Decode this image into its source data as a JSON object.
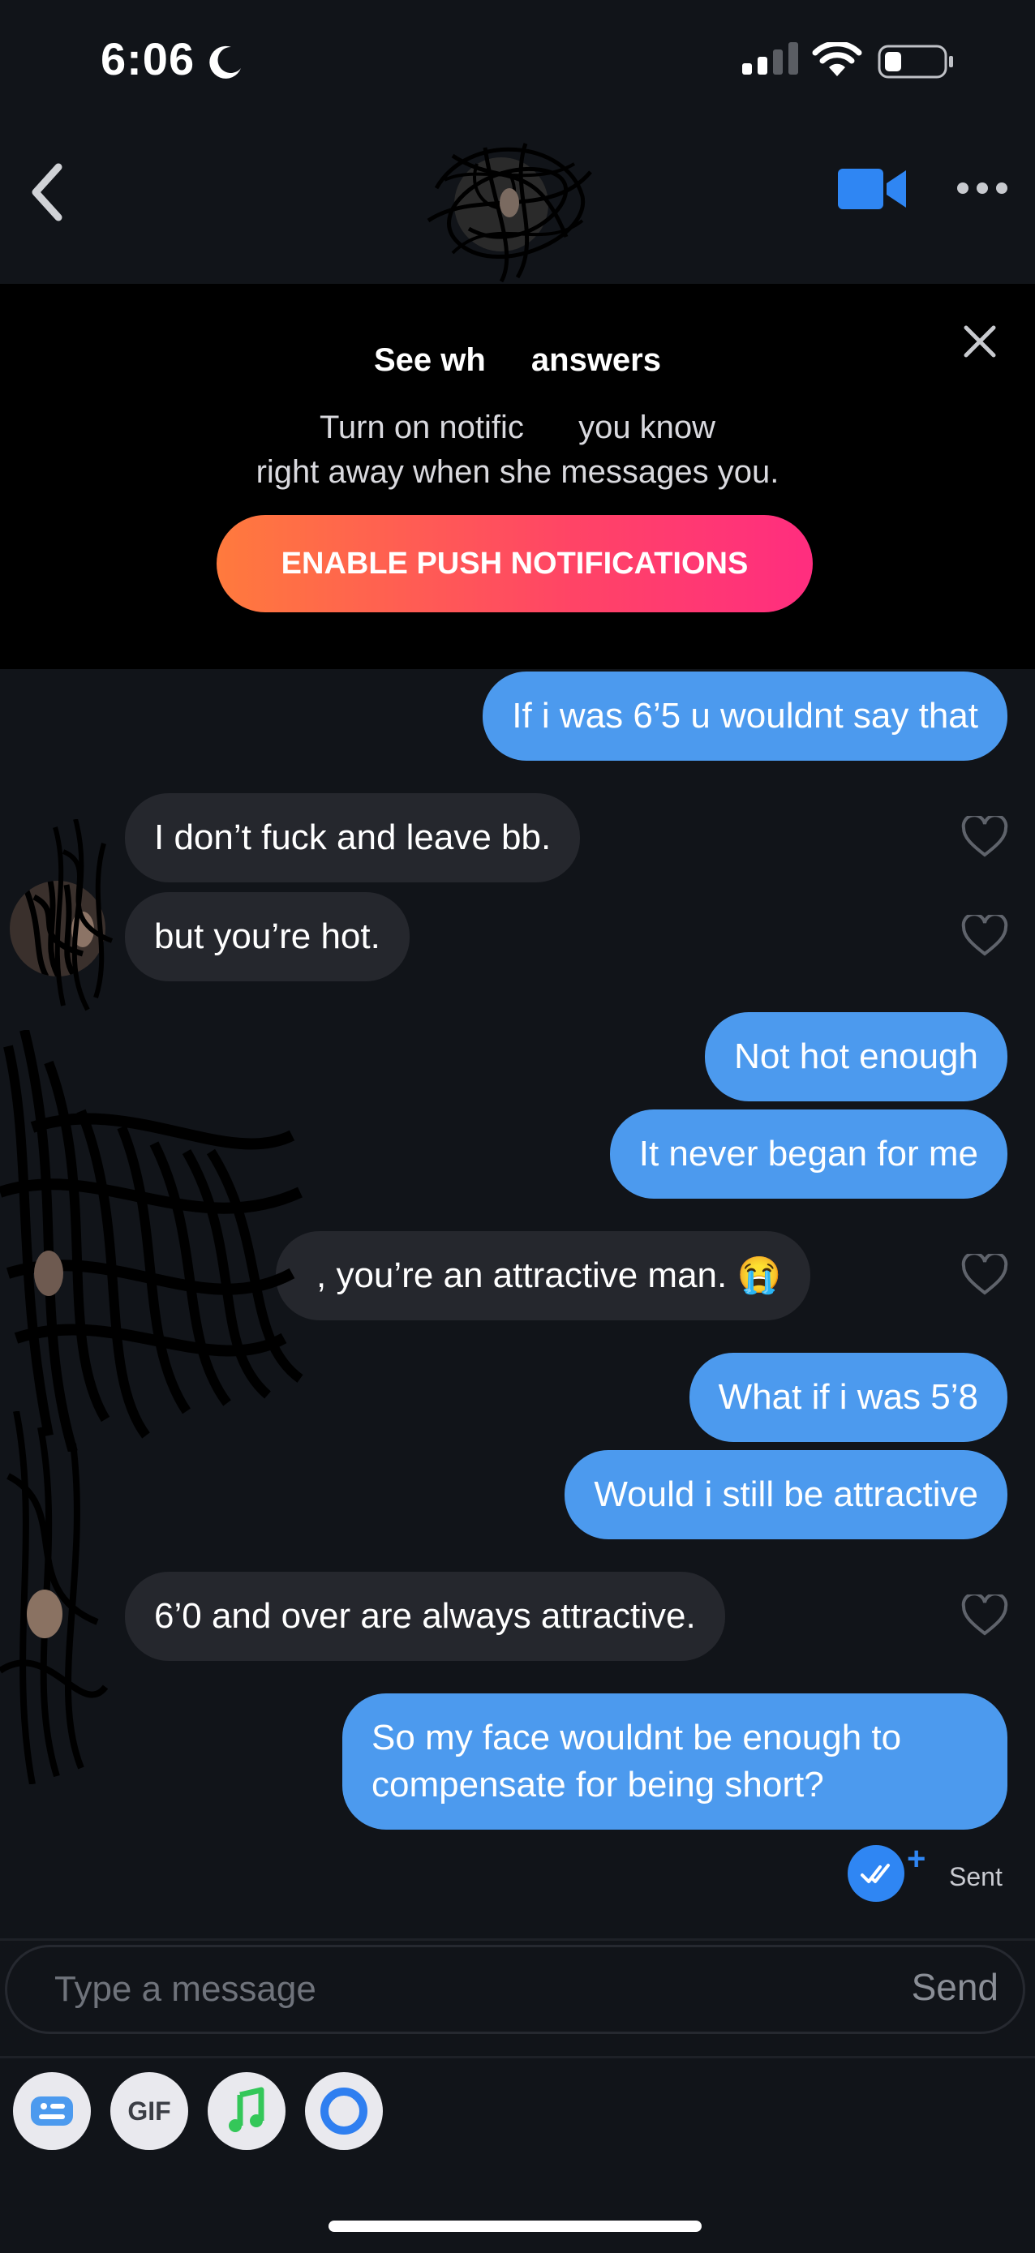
{
  "status_bar": {
    "time": "6:06"
  },
  "header": {
    "back_icon": "chevron-left-icon",
    "video_icon": "video-camera-icon",
    "more_icon": "ellipsis-icon"
  },
  "notification_banner": {
    "title": "See wh       answers",
    "body_line1": "Turn on notific        you know",
    "body_line2": "right away when she messages you.",
    "button_label": "ENABLE PUSH NOTIFICATIONS",
    "gradient_start": "#ff7a3d",
    "gradient_end": "#ff2d7f"
  },
  "messages": [
    {
      "direction": "outgoing",
      "text": "If i was 6’5 u wouldnt say that"
    },
    {
      "direction": "incoming",
      "text": "I don’t fuck and leave bb."
    },
    {
      "direction": "incoming",
      "text": "but you’re hot."
    },
    {
      "direction": "outgoing",
      "text": "Not hot enough"
    },
    {
      "direction": "outgoing",
      "text": "It never began for me"
    },
    {
      "direction": "incoming",
      "text": ", you’re an attractive man. 😭"
    },
    {
      "direction": "outgoing",
      "text": "What if i was 5’8"
    },
    {
      "direction": "outgoing",
      "text": "Would i still be attractive"
    },
    {
      "direction": "incoming",
      "text": "6’0 and over are always attractive."
    },
    {
      "direction": "outgoing",
      "text_line1": "So my face wouldnt be enough to",
      "text_line2": "compensate for being short?"
    }
  ],
  "receipt": {
    "plus": "+",
    "label": "Sent"
  },
  "composer": {
    "placeholder": "Type a message",
    "send_label": "Send"
  },
  "toolbar": {
    "gif_label": "GIF",
    "icons": [
      "sticker-icon",
      "gif-icon",
      "music-icon",
      "loop-icon"
    ]
  },
  "colors": {
    "background": "#111419",
    "outgoing_bubble": "#4c9aee",
    "incoming_bubble": "#25272d",
    "accent": "#2f86f3"
  }
}
